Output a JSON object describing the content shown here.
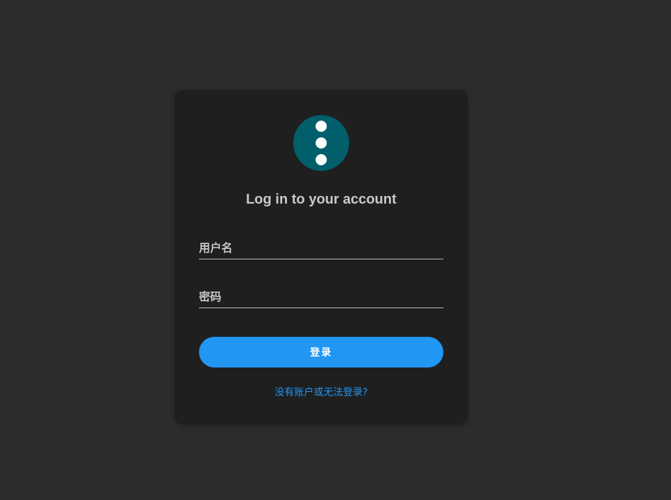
{
  "login": {
    "title": "Log in to your account",
    "logo_icon": "kebab-menu-icon",
    "username_placeholder": "用户名",
    "password_placeholder": "密码",
    "submit_label": "登录",
    "help_link": "没有账户或无法登录?"
  },
  "colors": {
    "background": "#2c2c2c",
    "card": "#1f1f1f",
    "logo": "#005f6b",
    "accent": "#2196f3"
  }
}
